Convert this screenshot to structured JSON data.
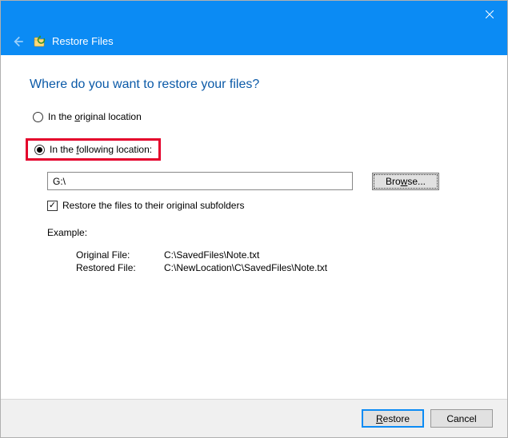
{
  "title": "Restore Files",
  "heading": "Where do you want to restore your files?",
  "radio": {
    "original_pre": "In the ",
    "original_u": "o",
    "original_post": "riginal location",
    "following_pre": "In the ",
    "following_u": "f",
    "following_post": "ollowing location:"
  },
  "location": {
    "value": "G:\\",
    "browse_pre": "Bro",
    "browse_u": "w",
    "browse_post": "se..."
  },
  "checkbox": {
    "label": "Restore the files to their original subfolders"
  },
  "example": {
    "label": "Example:",
    "original_label": "Original File:",
    "original_value": "C:\\SavedFiles\\Note.txt",
    "restored_label": "Restored File:",
    "restored_value": "C:\\NewLocation\\C\\SavedFiles\\Note.txt"
  },
  "footer": {
    "restore_u": "R",
    "restore_post": "estore",
    "cancel": "Cancel"
  }
}
